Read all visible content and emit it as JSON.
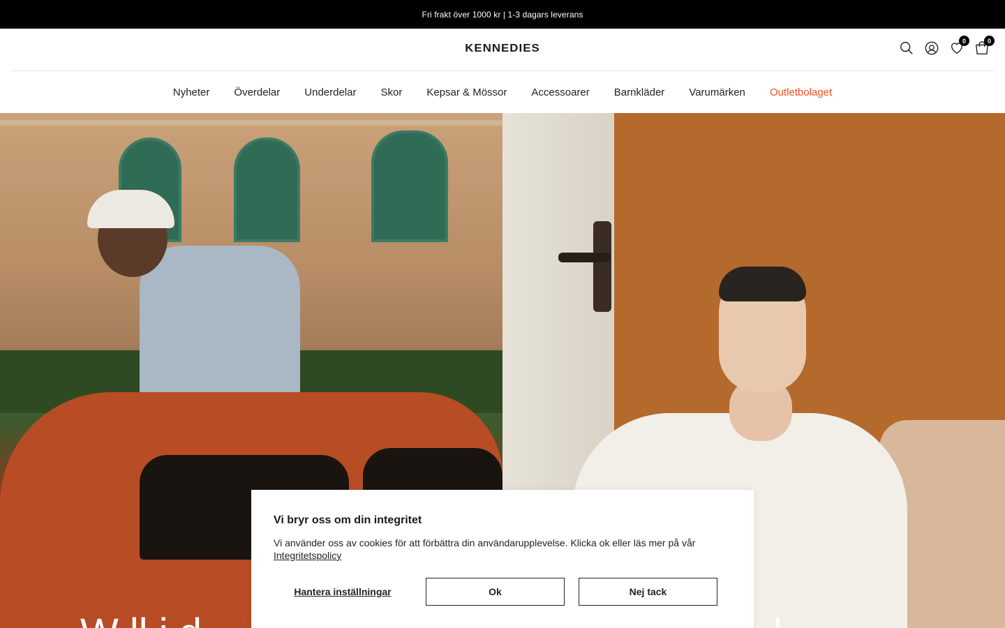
{
  "topbar": {
    "text": "Fri frakt över 1000 kr | 1-3 dagars leverans"
  },
  "header": {
    "logo": "KENNEDIES",
    "wishlist_count": "0",
    "cart_count": "0"
  },
  "nav": {
    "items": [
      {
        "label": "Nyheter"
      },
      {
        "label": "Överdelar"
      },
      {
        "label": "Underdelar"
      },
      {
        "label": "Skor"
      },
      {
        "label": "Kepsar & Mössor"
      },
      {
        "label": "Accessoarer"
      },
      {
        "label": "Barnkläder"
      },
      {
        "label": "Varumärken"
      },
      {
        "label": "Outletbolaget"
      }
    ],
    "outlet_color": "#f04e23"
  },
  "hero": {
    "headline_left": "W            ll   i   d",
    "headline_right": "l"
  },
  "cookie": {
    "title": "Vi bryr oss om din integritet",
    "text": "Vi använder oss av cookies för att förbättra din användarupplevelse. Klicka ok eller läs mer på vår",
    "link": "Integritetspolicy",
    "manage_label": "Hantera inställningar",
    "ok_label": "Ok",
    "decline_label": "Nej tack"
  }
}
